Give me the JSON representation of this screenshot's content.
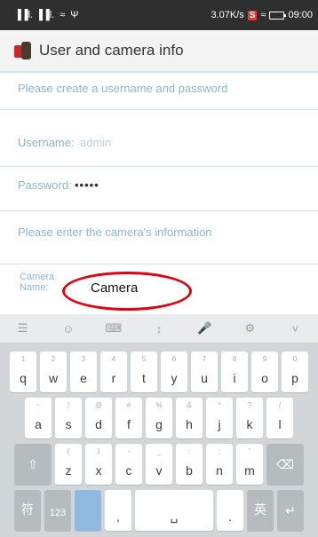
{
  "status_bar": {
    "signals": "▐▐l. ▐▐l.",
    "wifi_icon": "wifi-icon",
    "usb_icon": "usb-icon",
    "speed": "3.07K/s",
    "badge": "S",
    "time": "09:00"
  },
  "titlebar": {
    "title": "User and camera info"
  },
  "form": {
    "hint_credentials": "Please create a username and password",
    "username_label": "Username:",
    "username_value": "admin",
    "password_label": "Password:",
    "password_value": "•••••",
    "hint_camera": "Please enter the camera's information",
    "camera_label_1": "Camera",
    "camera_label_2": "Name:",
    "camera_value": "Camera"
  },
  "keyboard": {
    "tools": [
      "☰",
      "☺",
      "⌨",
      "↕",
      "🎤",
      "⚙",
      "˅"
    ],
    "row1": [
      {
        "k": "q",
        "s": "1"
      },
      {
        "k": "w",
        "s": "2"
      },
      {
        "k": "e",
        "s": "3"
      },
      {
        "k": "r",
        "s": "4"
      },
      {
        "k": "t",
        "s": "5"
      },
      {
        "k": "y",
        "s": "6"
      },
      {
        "k": "u",
        "s": "7"
      },
      {
        "k": "i",
        "s": "8"
      },
      {
        "k": "o",
        "s": "9"
      },
      {
        "k": "p",
        "s": "0"
      }
    ],
    "row2": [
      {
        "k": "a",
        "s": "~"
      },
      {
        "k": "s",
        "s": "!"
      },
      {
        "k": "d",
        "s": "@"
      },
      {
        "k": "f",
        "s": "#"
      },
      {
        "k": "g",
        "s": "%"
      },
      {
        "k": "h",
        "s": "&"
      },
      {
        "k": "j",
        "s": "*"
      },
      {
        "k": "k",
        "s": "?"
      },
      {
        "k": "l",
        "s": "/"
      }
    ],
    "row3": [
      {
        "k": "z",
        "s": "("
      },
      {
        "k": "x",
        "s": ")"
      },
      {
        "k": "c",
        "s": "-"
      },
      {
        "k": "v",
        "s": "_"
      },
      {
        "k": "b",
        "s": ":"
      },
      {
        "k": "n",
        "s": ";"
      },
      {
        "k": "m",
        "s": "\""
      }
    ],
    "shift": "⇧",
    "backspace": "⌫",
    "symbols": "符",
    "num": "123",
    "comma": ",",
    "space": "␣",
    "period": ".",
    "lang": "英",
    "enter": "↵"
  }
}
